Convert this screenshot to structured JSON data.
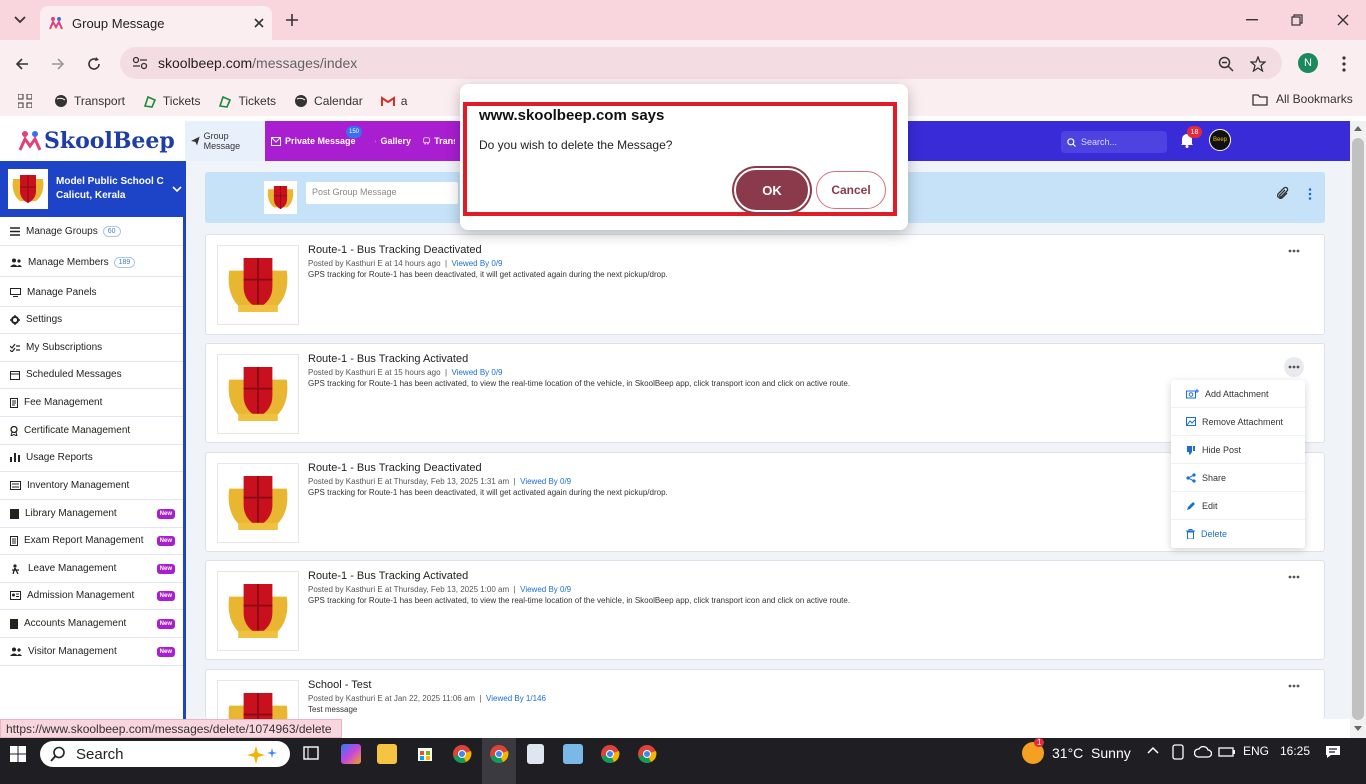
{
  "browser": {
    "tab_title": "Group Message",
    "url_host": "skoolbeep.com",
    "url_path": "/messages/index",
    "profile_initial": "N",
    "bookmarks": [
      "Transport",
      "Tickets",
      "Tickets",
      "Calendar",
      "a"
    ],
    "all_bookmarks": "All Bookmarks",
    "status_url": "https://www.skoolbeep.com/messages/delete/1074963/delete"
  },
  "app": {
    "logo": "SkoolBeep",
    "nav": {
      "group": "Group Message",
      "private": "Private Message",
      "private_badge": "150",
      "gallery": "Gallery",
      "transport": "Transp"
    },
    "search_placeholder": "Search...",
    "notifications": "18",
    "avatar_text": "Beep"
  },
  "sidebar": {
    "school_name": "Model Public School C",
    "school_location": "Calicut, Kerala",
    "items": [
      {
        "label": "Manage Groups",
        "count": "60",
        "new": ""
      },
      {
        "label": "Manage Members",
        "count": "189",
        "new": ""
      },
      {
        "label": "Manage Panels",
        "count": "",
        "new": ""
      },
      {
        "label": "Settings",
        "count": "",
        "new": ""
      },
      {
        "label": "My Subscriptions",
        "count": "",
        "new": ""
      },
      {
        "label": "Scheduled Messages",
        "count": "",
        "new": ""
      },
      {
        "label": "Fee Management",
        "count": "",
        "new": ""
      },
      {
        "label": "Certificate Management",
        "count": "",
        "new": ""
      },
      {
        "label": "Usage Reports",
        "count": "",
        "new": ""
      },
      {
        "label": "Inventory Management",
        "count": "",
        "new": ""
      },
      {
        "label": "Library Management",
        "count": "",
        "new": "New"
      },
      {
        "label": "Exam Report Management",
        "count": "",
        "new": "New"
      },
      {
        "label": "Leave Management",
        "count": "",
        "new": "New"
      },
      {
        "label": "Admission Management",
        "count": "",
        "new": "New"
      },
      {
        "label": "Accounts Management",
        "count": "",
        "new": "New"
      },
      {
        "label": "Visitor Management",
        "count": "",
        "new": "New"
      }
    ]
  },
  "composer": {
    "placeholder": "Post Group Message"
  },
  "messages": [
    {
      "title": "Route-1 - Bus Tracking Deactivated",
      "meta": "Posted by Kasthuri E at 14 hours ago",
      "viewed": "Viewed By 0/9",
      "body": "GPS tracking for Route-1 has been deactivated, it will get activated again during the next pickup/drop."
    },
    {
      "title": "Route-1 - Bus Tracking Activated",
      "meta": "Posted by Kasthuri E at 15 hours ago",
      "viewed": "Viewed By 0/9",
      "body": "GPS tracking for Route-1 has been activated, to view the real-time location of the vehicle, in SkoolBeep app, click transport icon and click on active route."
    },
    {
      "title": "Route-1 - Bus Tracking Deactivated",
      "meta": "Posted by Kasthuri E at Thursday, Feb 13, 2025 1:31 am",
      "viewed": "Viewed By 0/9",
      "body": "GPS tracking for Route-1 has been deactivated, it will get activated again during the next pickup/drop."
    },
    {
      "title": "Route-1 - Bus Tracking Activated",
      "meta": "Posted by Kasthuri E at Thursday, Feb 13, 2025 1:00 am",
      "viewed": "Viewed By 0/9",
      "body": "GPS tracking for Route-1 has been activated, to view the real-time location of the vehicle, in SkoolBeep app, click transport icon and click on active route."
    },
    {
      "title": "School - Test",
      "meta": "Posted by Kasthuri E at Jan 22, 2025 11:06 am",
      "viewed": "Viewed By 1/146",
      "body": "Test message"
    }
  ],
  "context_menu": [
    "Add Attachment",
    "Remove Attachment",
    "Hide Post",
    "Share",
    "Edit",
    "Delete"
  ],
  "dialog": {
    "title": "www.skoolbeep.com says",
    "message": "Do you wish to delete the Message?",
    "ok": "OK",
    "cancel": "Cancel"
  },
  "taskbar": {
    "search": "Search",
    "weather_badge": "1",
    "weather": "31°C  Sunny",
    "lang": "ENG",
    "time": "16:25"
  },
  "colors": {
    "header": "#3a2bd8",
    "nav_purple": "#a81ed0",
    "sidebar_blue": "#1d44c7",
    "dialog_border": "#e01c26",
    "ok_button": "#8a3a4a"
  }
}
